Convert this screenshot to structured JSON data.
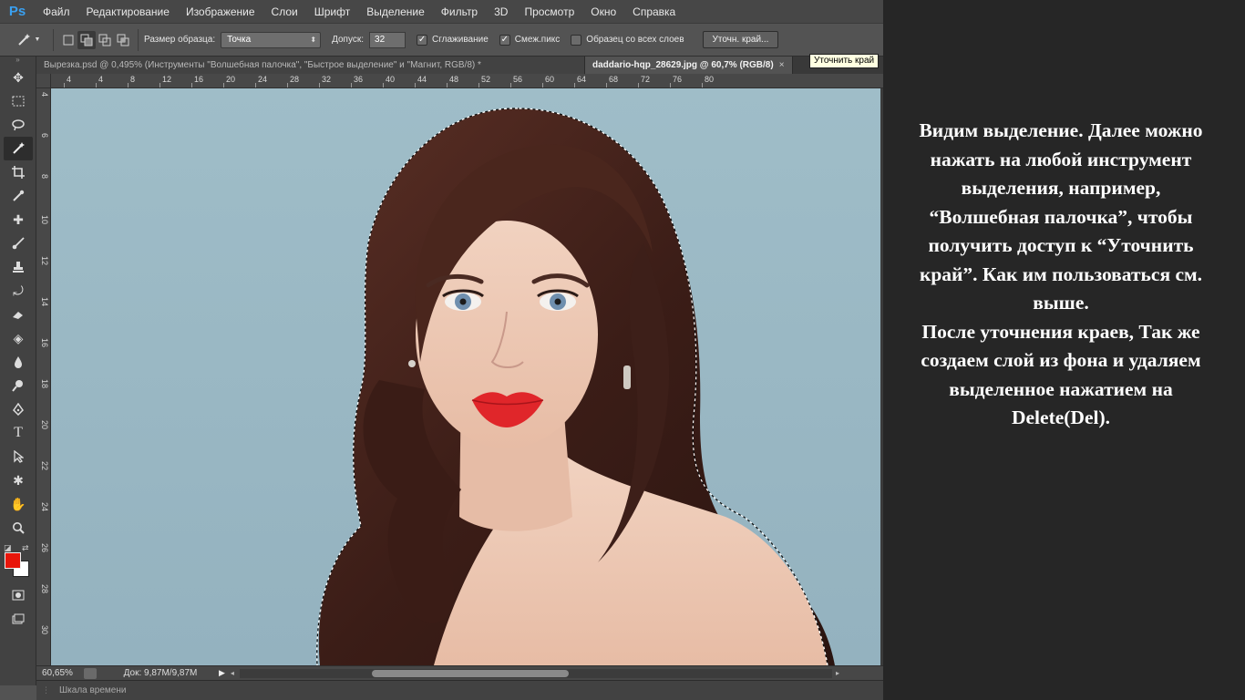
{
  "menubar": {
    "logo": "Ps",
    "items": [
      "Файл",
      "Редактирование",
      "Изображение",
      "Слои",
      "Шрифт",
      "Выделение",
      "Фильтр",
      "3D",
      "Просмотр",
      "Окно",
      "Справка"
    ]
  },
  "options": {
    "sample_size_label": "Размер образца:",
    "sample_size_value": "Точка",
    "tolerance_label": "Допуск:",
    "tolerance_value": "32",
    "antialias_label": "Сглаживание",
    "antialias_checked": true,
    "contiguous_label": "Смеж.пикс",
    "contiguous_checked": true,
    "sample_all_label": "Образец со всех слоев",
    "sample_all_checked": false,
    "refine_edge_button": "Уточн. край..."
  },
  "tabs": [
    {
      "label": "Вырезка.psd @ 0,495% (Инструменты  \"Волшебная палочка\", \"Быстрое выделение\" и \"Магнит, RGB/8) *",
      "active": false
    },
    {
      "label": "daddario-hqp_28629.jpg @ 60,7% (RGB/8)",
      "active": true
    }
  ],
  "tab_close": "×",
  "tooltip": "Уточнить край",
  "ruler_top": [
    "4",
    "4",
    "8",
    "12",
    "16",
    "20",
    "24",
    "28",
    "32",
    "36",
    "40",
    "44",
    "48",
    "52",
    "56",
    "60",
    "64",
    "68",
    "72",
    "76",
    "80"
  ],
  "ruler_left": [
    "4",
    "6",
    "8",
    "1 0",
    "1 2",
    "1 4",
    "1 6",
    "1 8",
    "2 0",
    "2 2",
    "2 4",
    "2 6",
    "2 8",
    "3 0"
  ],
  "colors": {
    "foreground": "#e8150a",
    "background": "#ffffff",
    "canvas_bg": "#9cbac6",
    "ps_logo": "#3aa0f0"
  },
  "status": {
    "zoom": "60,65%",
    "doc_label": "Док: 9,87M/9,87M",
    "horizontal_scroll_position": 0.335
  },
  "timeline_label": "Шкала времени",
  "note": {
    "paragraph1": "Видим выделение. Далее можно нажать на любой инструмент выделения, например, “Волшебная палочка”, чтобы получить доступ к “Уточнить край”. Как им пользоваться см. выше.",
    "paragraph2": "После уточнения краев, Так же создаем слой из фона и удаляем выделенное нажатием на Delete(Del)."
  }
}
